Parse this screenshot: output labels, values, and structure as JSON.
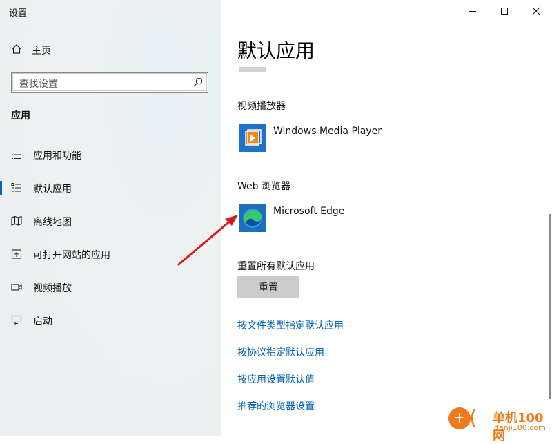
{
  "window": {
    "title": "设置"
  },
  "sidebar": {
    "home_label": "主页",
    "search_placeholder": "查找设置",
    "section_title": "应用",
    "items": [
      {
        "label": "应用和功能",
        "icon": "apps-features-icon",
        "selected": false
      },
      {
        "label": "默认应用",
        "icon": "default-apps-icon",
        "selected": true
      },
      {
        "label": "离线地图",
        "icon": "offline-maps-icon",
        "selected": false
      },
      {
        "label": "可打开网站的应用",
        "icon": "apps-for-websites-icon",
        "selected": false
      },
      {
        "label": "视频播放",
        "icon": "video-playback-icon",
        "selected": false
      },
      {
        "label": "启动",
        "icon": "startup-icon",
        "selected": false
      }
    ],
    "accent_color": "#0063b1"
  },
  "main": {
    "title": "默认应用",
    "video_player": {
      "label": "视频播放器",
      "app_name": "Windows Media Player"
    },
    "web_browser": {
      "label": "Web 浏览器",
      "app_name": "Microsoft Edge"
    },
    "reset": {
      "label": "重置所有默认应用",
      "button_label": "重置"
    },
    "links": [
      "按文件类型指定默认应用",
      "按协议指定默认应用",
      "按应用设置默认值",
      "推荐的浏览器设置"
    ],
    "link_color": "#0063b1"
  },
  "watermark": {
    "logo_glyph": "+",
    "text": "单机100网",
    "url": "danji100.com",
    "color": "#f07a1a"
  },
  "annotation": {
    "arrow_color": "#d7191c"
  }
}
